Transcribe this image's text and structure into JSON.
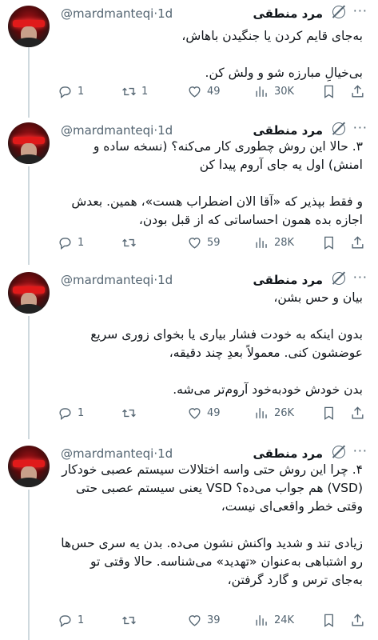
{
  "tweets": [
    {
      "display_name": "مرد منطقی",
      "handle": "@mardmanteqi",
      "time": "1d",
      "paragraphs": [
        "به‌جای قایم کردن یا جنگیدن باهاش،",
        "بی‌خیالِ مبارزه شو و ولش کن."
      ],
      "replies": "1",
      "reposts": "1",
      "likes": "49",
      "views": "30K"
    },
    {
      "display_name": "مرد منطقی",
      "handle": "@mardmanteqi",
      "time": "1d",
      "paragraphs": [
        "۳. حالا این روش چطوری کار می‌کنه؟ (نسخه ساده و امنش) اول یه جای آروم پیدا کن",
        "و فقط بپذیر که «آقا الان اضطراب هست»، همین. بعدش اجازه بده همون احساساتی که از قبل بودن،"
      ],
      "replies": "1",
      "reposts": "",
      "likes": "59",
      "views": "28K"
    },
    {
      "display_name": "مرد منطقی",
      "handle": "@mardmanteqi",
      "time": "1d",
      "paragraphs": [
        "بیان و حس بشن،",
        "بدون اینکه به خودت فشار بیاری یا بخوای زوری سریع عوضشون کنی. معمولاً بعدِ چند دقیقه،",
        "بدن خودش خودبه‌خود آروم‌تر می‌شه."
      ],
      "replies": "1",
      "reposts": "",
      "likes": "49",
      "views": "26K"
    },
    {
      "display_name": "مرد منطقی",
      "handle": "@mardmanteqi",
      "time": "1d",
      "paragraphs": [
        "۴. چرا این روش حتی واسه اختلالات سیستم عصبی خودکار (VSD) هم جواب می‌ده؟ VSD یعنی سیستم عصبی حتی وقتی خطر واقعی‌ای نیست،",
        "زیادی تند و شدید واکنش نشون می‌ده. بدن یه سری حس‌ها رو اشتباهی به‌عنوان «تهدید» می‌شناسه. حالا وقتی تو به‌جای ترس و گارد گرفتن،"
      ],
      "replies": "1",
      "reposts": "",
      "likes": "39",
      "views": "24K"
    }
  ],
  "separator": "·",
  "more_icon": "more-dots-icon",
  "grok_icon": "grok-icon"
}
